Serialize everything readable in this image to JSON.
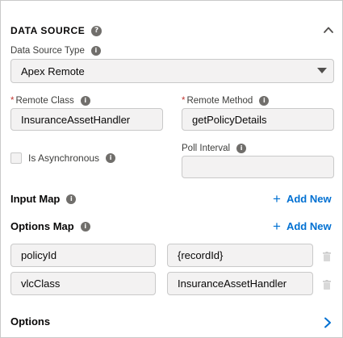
{
  "data_source": {
    "title": "DATA SOURCE",
    "help_icon": "question-circle-icon",
    "collapse_icon": "chevron-up-icon"
  },
  "type_field": {
    "label": "Data Source Type",
    "value": "Apex Remote"
  },
  "remote_class": {
    "required_mark": "*",
    "label": "Remote Class",
    "value": "InsuranceAssetHandler"
  },
  "remote_method": {
    "required_mark": "*",
    "label": "Remote Method",
    "value": "getPolicyDetails"
  },
  "async": {
    "label": "Is Asynchronous",
    "checked": false
  },
  "poll_interval": {
    "label": "Poll Interval",
    "value": ""
  },
  "input_map": {
    "title": "Input Map",
    "add_label": "Add New"
  },
  "options_map": {
    "title": "Options Map",
    "add_label": "Add New",
    "rows": [
      {
        "key": "policyId",
        "value": "{recordId}"
      },
      {
        "key": "vlcClass",
        "value": "InsuranceAssetHandler"
      }
    ]
  },
  "options": {
    "title": "Options",
    "icon": "chevron-right-icon"
  },
  "colors": {
    "accent": "#0070d2",
    "required": "#c23934",
    "icon_gray": "#706e6b"
  }
}
